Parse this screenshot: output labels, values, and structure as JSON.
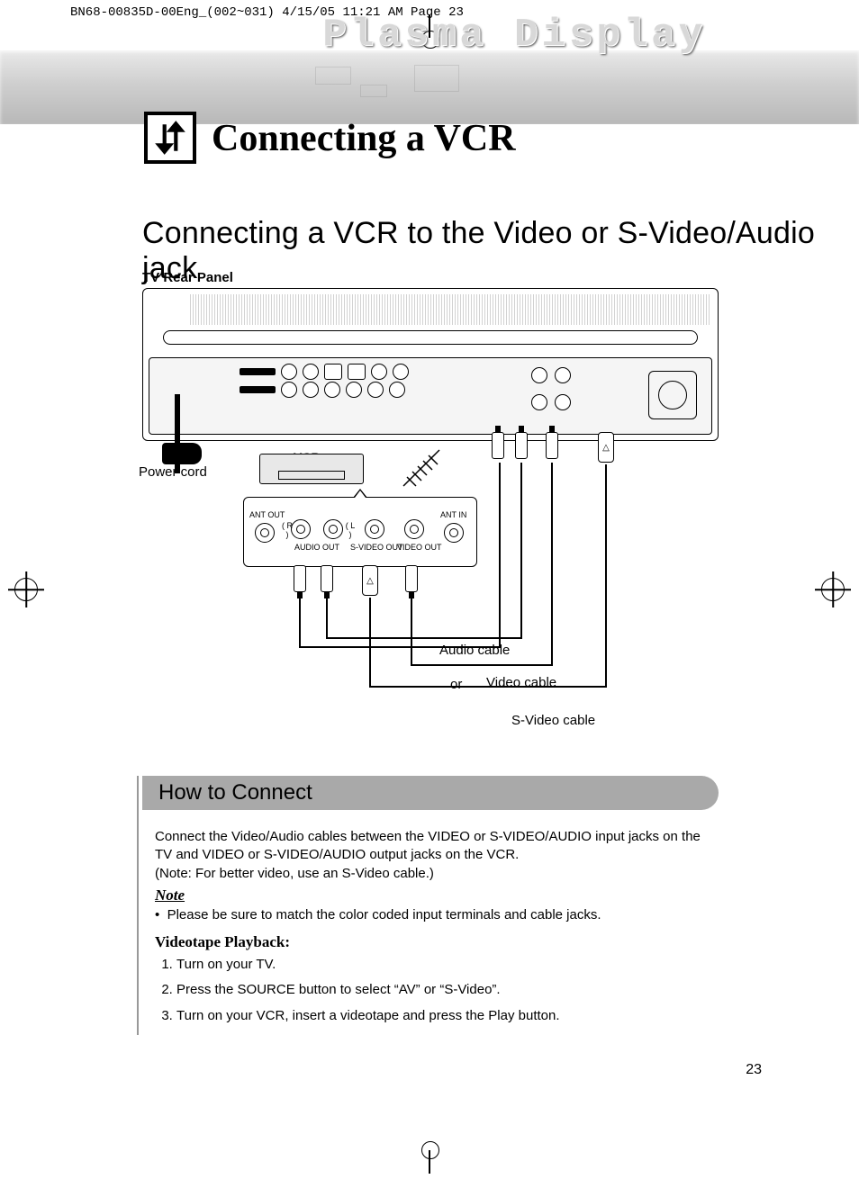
{
  "print_header": "BN68-00835D-00Eng_(002~031)  4/15/05  11:21 AM  Page 23",
  "banner_title": "Plasma Display",
  "main_title": "Connecting a VCR",
  "subtitle": "Connecting a VCR to the Video or S-Video/Audio jack",
  "panel_label": "TV Rear Panel",
  "diagram": {
    "vcr": "VCR",
    "power_cord": "Power cord",
    "audio_cable": "Audio cable",
    "video_cable": "Video cable",
    "svideo_cable": "S-Video cable",
    "or": "or",
    "vcr_jacks": {
      "ant_out": "ANT OUT",
      "r": "( R )",
      "l": "( L )",
      "audio_out": "AUDIO OUT",
      "svideo_out": "S-VIDEO OUT",
      "video_out": "VIDEO OUT",
      "ant_in": "ANT IN"
    }
  },
  "how_to_connect": "How to Connect",
  "connect_text_1": "Connect the Video/Audio cables between the VIDEO or S-VIDEO/AUDIO input jacks on the TV and VIDEO or S-VIDEO/AUDIO output jacks on the VCR.",
  "connect_text_2": "(Note: For better video, use an S-Video cable.)",
  "note_label": "Note",
  "note_bullet": "Please be sure to match the color coded input terminals and cable jacks.",
  "videotape_label": "Videotape Playback:",
  "steps": [
    "Turn on your TV.",
    "Press the SOURCE button to select “AV” or “S-Video”.",
    "Turn on your VCR, insert a videotape and press the Play button."
  ],
  "page_number": "23"
}
